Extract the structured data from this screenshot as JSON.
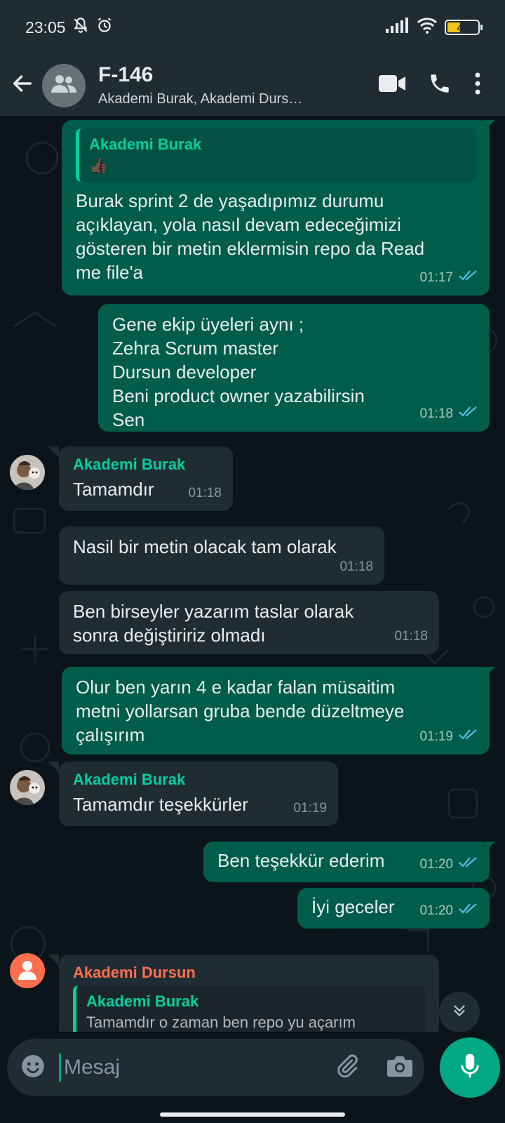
{
  "status_bar": {
    "time": "23:05",
    "battery": "40",
    "battery_level": 0.4
  },
  "header": {
    "title": "F-146",
    "subtitle": "Akademi Burak, Akademi Durs…"
  },
  "messages": [
    {
      "id": "m1",
      "type": "out",
      "quote_author": "Akademi Burak",
      "quote_text": "👍🏿",
      "text": "Burak sprint 2 de yaşadıpımız durumu\naçıklayan, yola nasıl devam edeceğimizi\ngösteren bir metin eklermisin repo da Read\nme file'a",
      "time": "01:17"
    },
    {
      "id": "m2",
      "type": "out",
      "text": "Gene ekip üyeleri aynı ;\nZehra Scrum master\nDursun developer\nBeni product owner yazabilirsin\nSen",
      "time": "01:18"
    },
    {
      "id": "m3",
      "type": "in",
      "sender": "Akademi Burak",
      "text": "Tamamdır",
      "time": "01:18"
    },
    {
      "id": "m4",
      "type": "in",
      "text": "Nasil bir metin olacak tam olarak",
      "time": "01:18"
    },
    {
      "id": "m5",
      "type": "in",
      "text": "Ben birseyler yazarım taslar olarak\nsonra değiştiririz olmadı",
      "time": "01:18"
    },
    {
      "id": "m6",
      "type": "out",
      "text": "Olur ben yarın 4 e kadar falan müsaitim\nmetni yollarsan gruba bende düzeltmeye\nçalışırım",
      "time": "01:19"
    },
    {
      "id": "m7",
      "type": "in",
      "sender": "Akademi Burak",
      "text": "Tamamdır teşekkürler",
      "time": "01:19"
    },
    {
      "id": "m8",
      "type": "out",
      "text": "Ben teşekkür ederim",
      "time": "01:20"
    },
    {
      "id": "m9",
      "type": "out",
      "text": "İyi geceler",
      "time": "01:20"
    },
    {
      "id": "m10",
      "type": "in",
      "sender": "Akademi Dursun",
      "quote_author": "Akademi Burak",
      "quote_text": "Tamamdır o zaman ben repo yu açarım"
    }
  ],
  "composer": {
    "placeholder": "Mesaj"
  },
  "colors": {
    "accent": "#00a884",
    "outgoing": "#005c4b",
    "incoming": "#202c33",
    "background": "#0b141a"
  }
}
